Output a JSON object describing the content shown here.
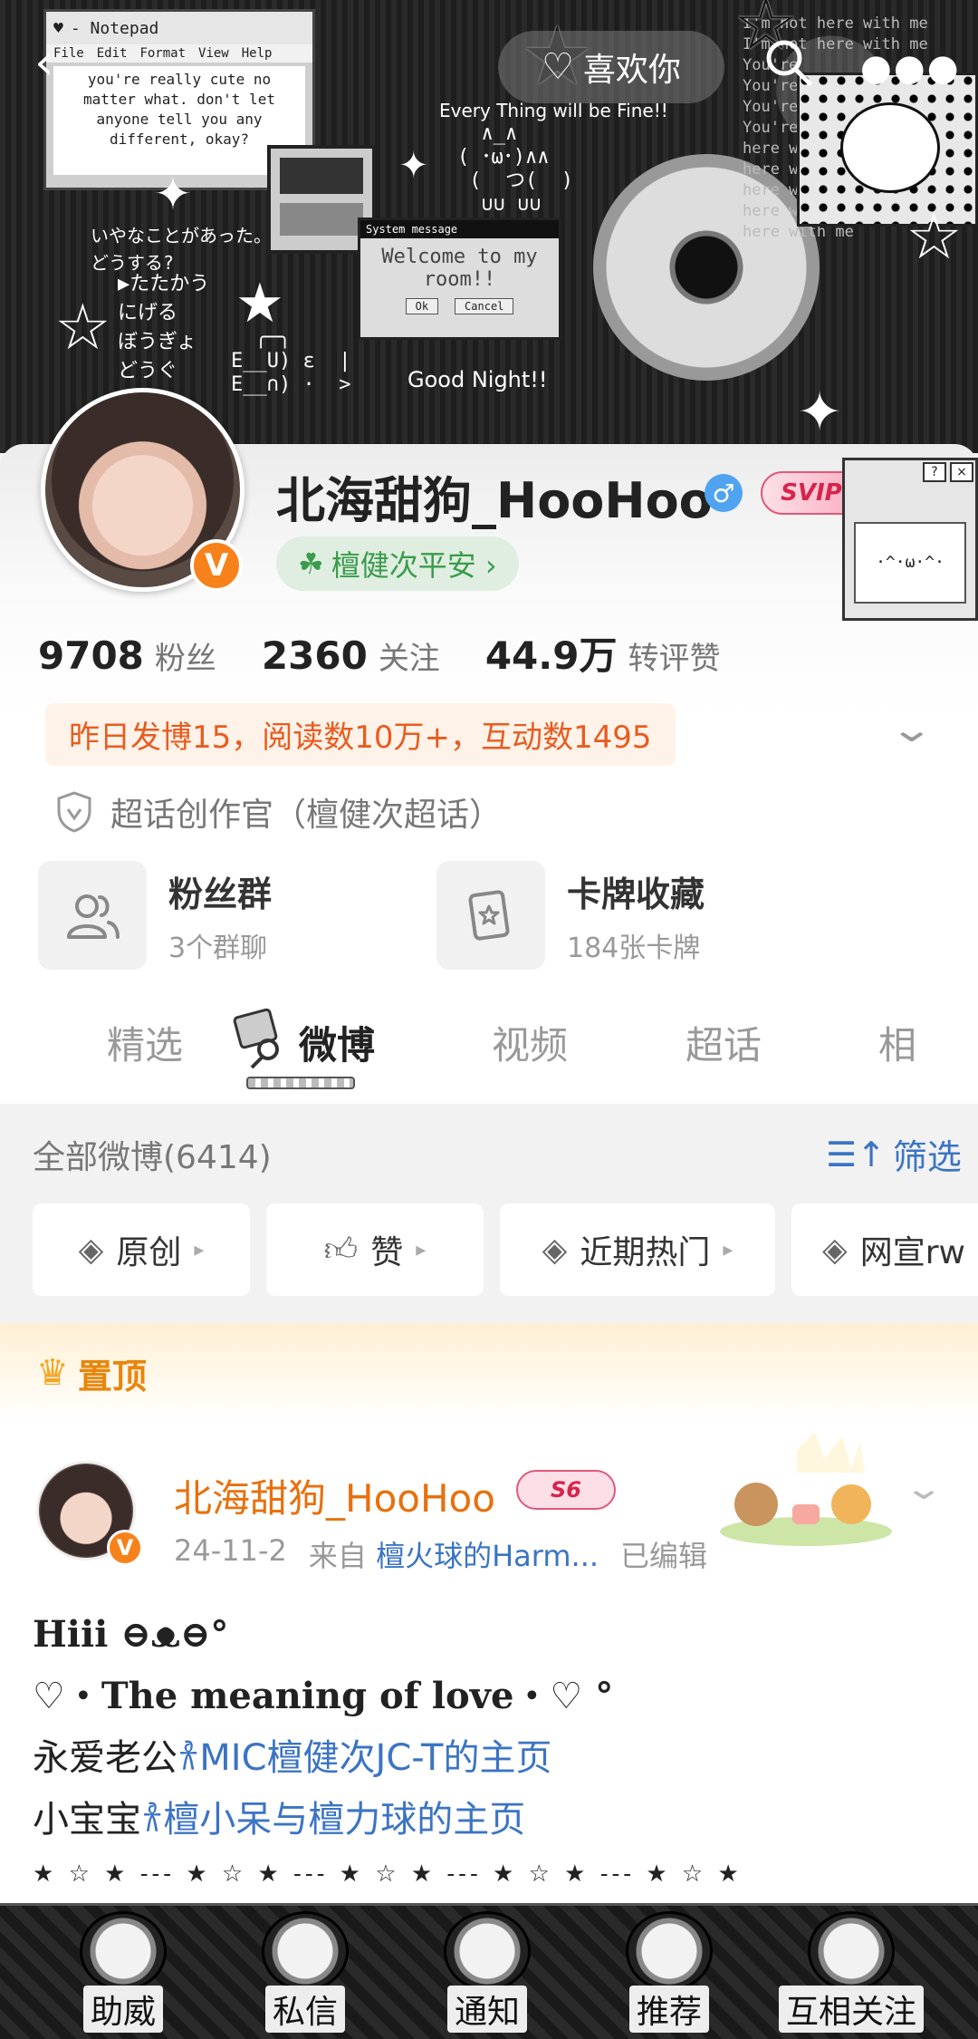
{
  "header": {
    "like_label": "喜欢你",
    "notepad": {
      "title": "- Notepad",
      "menu": [
        "File",
        "Edit",
        "Format",
        "View",
        "Help"
      ],
      "text": "you're really cute no matter what. don't let anyone tell you any different, okay?"
    },
    "every_thing": "Every Thing will be Fine!!",
    "good_night": "Good Night!!",
    "jp_text_1": "いやなことがあった。\nどうする?",
    "jp_text_2": "▶たたかう\nにげる\nぼうぎょ\nどうぐ",
    "system_message": {
      "title": "System message",
      "body": "Welcome to my room!!",
      "ok": "Ok",
      "cancel": "Cancel"
    },
    "right_text": "I'm not here with me\nI'm not here with me\nYou're\nYou're\nYou're\nYou're\nhere with\nhere with\nhere with me\nhere with me\nhere with me"
  },
  "profile": {
    "nickname": "北海甜狗_HooHoo",
    "gender_symbol": "♂",
    "svip_label": "SVIP6",
    "mini_window_text": "·^·ω·^·",
    "tag": "檀健次平安 ›",
    "stats": [
      {
        "num": "9708",
        "label": "粉丝"
      },
      {
        "num": "2360",
        "label": "关注"
      },
      {
        "num": "44.9万",
        "label": "转评赞"
      }
    ],
    "yesterday": "昨日发博15，阅读数10万+，互动数1495",
    "creator": "超话创作官（檀健次超话）",
    "cards": [
      {
        "title": "粉丝群",
        "sub": "3个群聊"
      },
      {
        "title": "卡牌收藏",
        "sub": "184张卡牌"
      }
    ]
  },
  "tabs": [
    "精选",
    "微博",
    "视频",
    "超话",
    "相"
  ],
  "filter": {
    "all_label": "全部微博(6414)",
    "filter_label": "筛选",
    "chips": [
      "原创",
      "赞",
      "近期热门",
      "网宣rw"
    ]
  },
  "post": {
    "pinned_label": "置顶",
    "author": "北海甜狗_HooHoo",
    "level_badge": "S6",
    "date": "24-11-2",
    "from_label": "来自",
    "source": "檀火球的Harm...",
    "edited": "已编辑",
    "line1": "Hiii ⊖ᴥ⊖°",
    "line2": "♡・The meaning of love・♡ °",
    "line3_prefix": "永爱老公",
    "line3_link": "𐀪MIC檀健次JC-T的主页",
    "line4_prefix": "小宝宝",
    "line4_link": "𐀪檀小呆与檀力球的主页",
    "stars": "★ ☆ ★ --- ★ ☆ ★ --- ★ ☆ ★ --- ★ ☆ ★ --- ★ ☆ ★"
  },
  "bottom_nav": [
    "助威",
    "私信",
    "通知",
    "推荐",
    "互相关注"
  ]
}
